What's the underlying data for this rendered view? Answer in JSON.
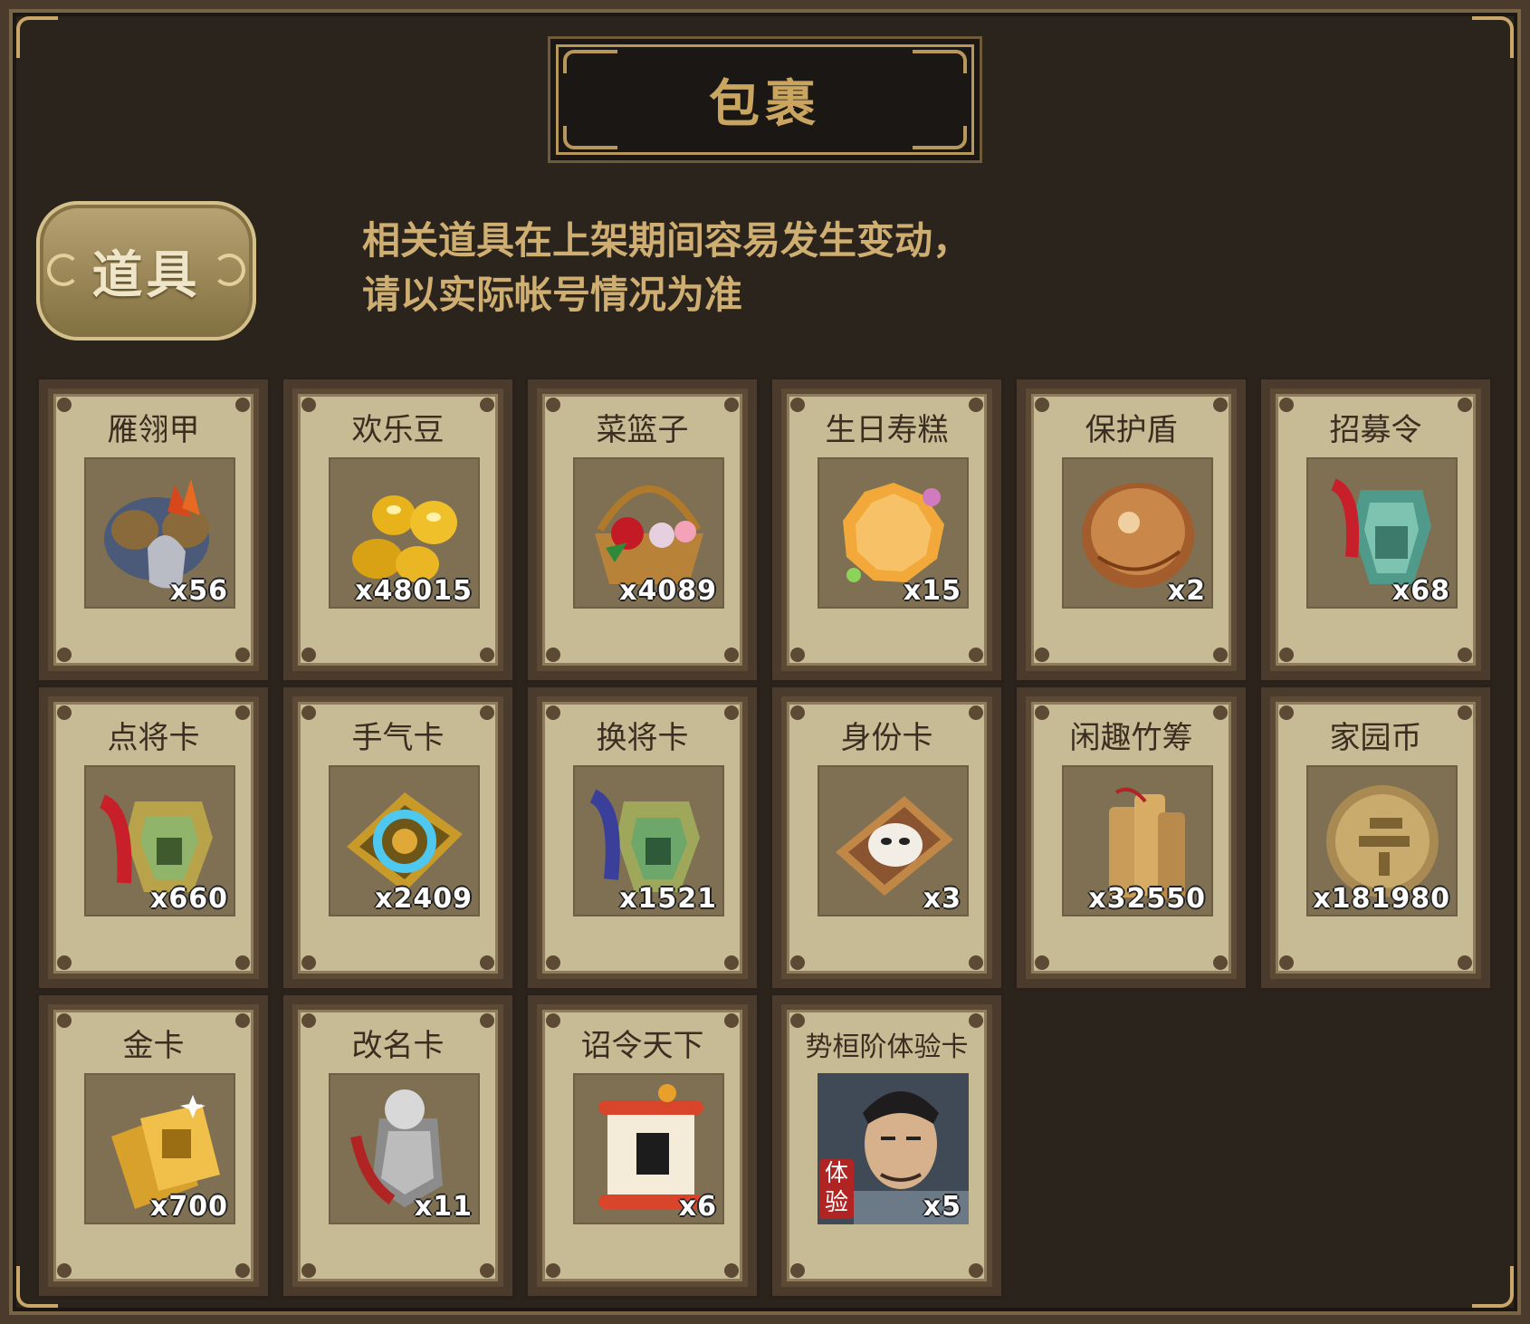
{
  "title": "包裹",
  "tab": {
    "label": "道具"
  },
  "notice": {
    "line1": "相关道具在上架期间容易发生变动，",
    "line2": "请以实际帐号情况为准"
  },
  "items": [
    {
      "name": "雁翎甲",
      "qty": "x56",
      "icon": "armor-icon"
    },
    {
      "name": "欢乐豆",
      "qty": "x48015",
      "icon": "gold-beans-icon"
    },
    {
      "name": "菜篮子",
      "qty": "x4089",
      "icon": "basket-icon"
    },
    {
      "name": "生日寿糕",
      "qty": "x15",
      "icon": "cake-icon"
    },
    {
      "name": "保护盾",
      "qty": "x2",
      "icon": "shield-icon"
    },
    {
      "name": "招募令",
      "qty": "x68",
      "icon": "recruit-token-icon"
    },
    {
      "name": "点将卡",
      "qty": "x660",
      "icon": "general-card-icon"
    },
    {
      "name": "手气卡",
      "qty": "x2409",
      "icon": "luck-card-icon"
    },
    {
      "name": "换将卡",
      "qty": "x1521",
      "icon": "swap-card-icon"
    },
    {
      "name": "身份卡",
      "qty": "x3",
      "icon": "identity-card-icon"
    },
    {
      "name": "闲趣竹筹",
      "qty": "x32550",
      "icon": "bamboo-tally-icon"
    },
    {
      "name": "家园币",
      "qty": "x181980",
      "icon": "home-coin-icon"
    },
    {
      "name": "金卡",
      "qty": "x700",
      "icon": "gold-card-icon"
    },
    {
      "name": "改名卡",
      "qty": "x11",
      "icon": "rename-card-icon"
    },
    {
      "name": "诏令天下",
      "qty": "x6",
      "icon": "edict-scroll-icon"
    },
    {
      "name": "势桓阶体验卡",
      "qty": "x5",
      "icon": "general-portrait-icon",
      "badge": "体验"
    }
  ],
  "colors": {
    "panel": "#2b241d",
    "gold": "#c9a560",
    "card": "#c7bb95"
  }
}
